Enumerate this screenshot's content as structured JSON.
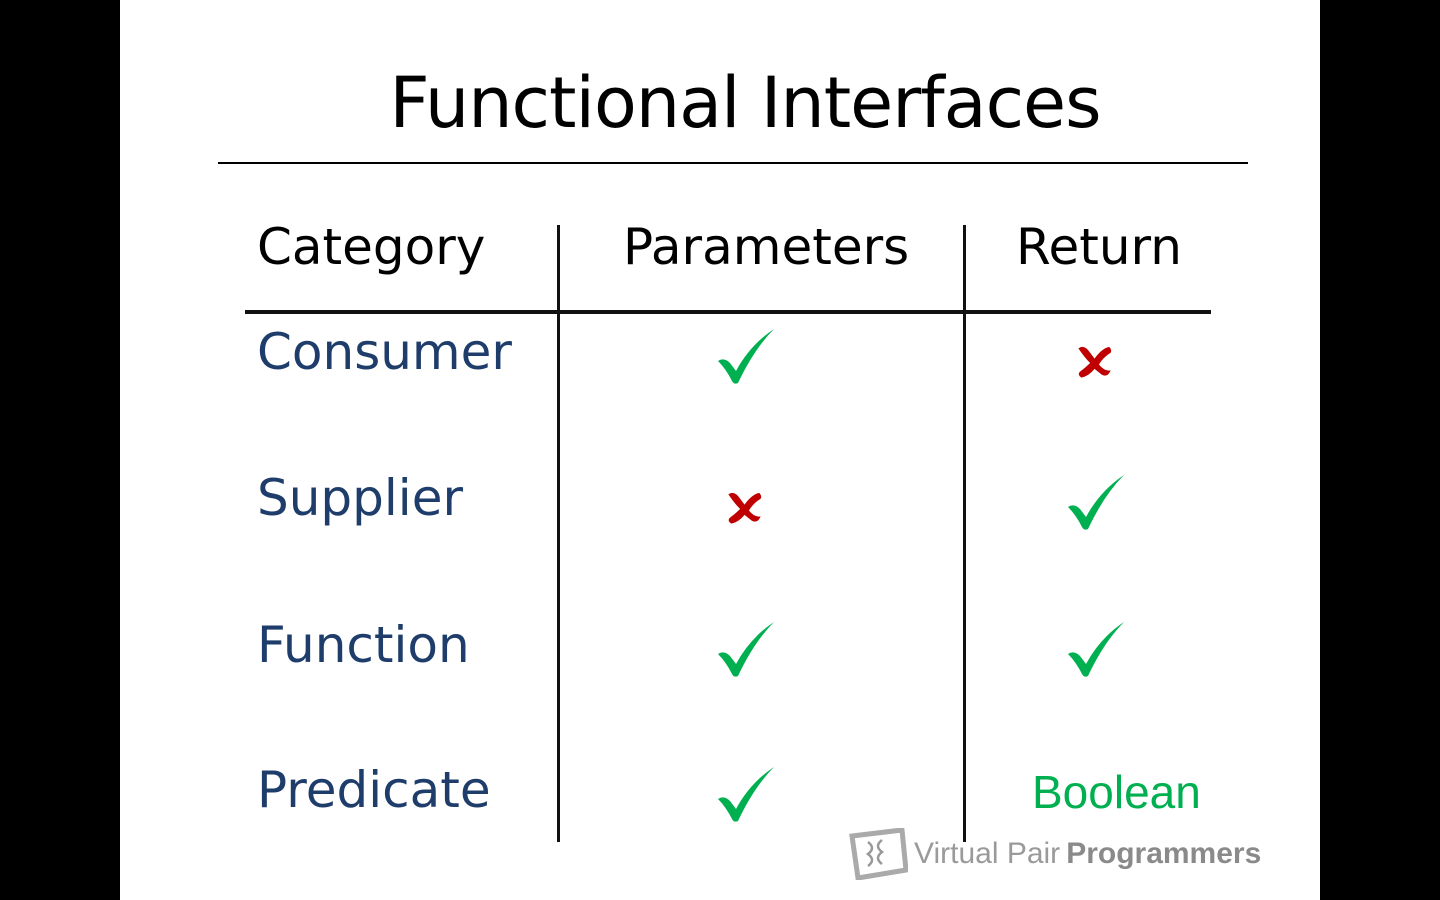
{
  "title": "Functional Interfaces",
  "headers": {
    "category": "Category",
    "parameters": "Parameters",
    "return": "Return"
  },
  "rows": [
    {
      "category": "Consumer",
      "parameters": "check",
      "return": "cross"
    },
    {
      "category": "Supplier",
      "parameters": "cross",
      "return": "check"
    },
    {
      "category": "Function",
      "parameters": "check",
      "return": "check"
    },
    {
      "category": "Predicate",
      "parameters": "check",
      "return": "Boolean"
    }
  ],
  "colors": {
    "category_text": "#1f3d6b",
    "check": "#00b050",
    "cross": "#c00000",
    "boolean_text": "#00b050"
  },
  "watermark": {
    "light": "Virtual Pair",
    "bold": "Programmers"
  }
}
